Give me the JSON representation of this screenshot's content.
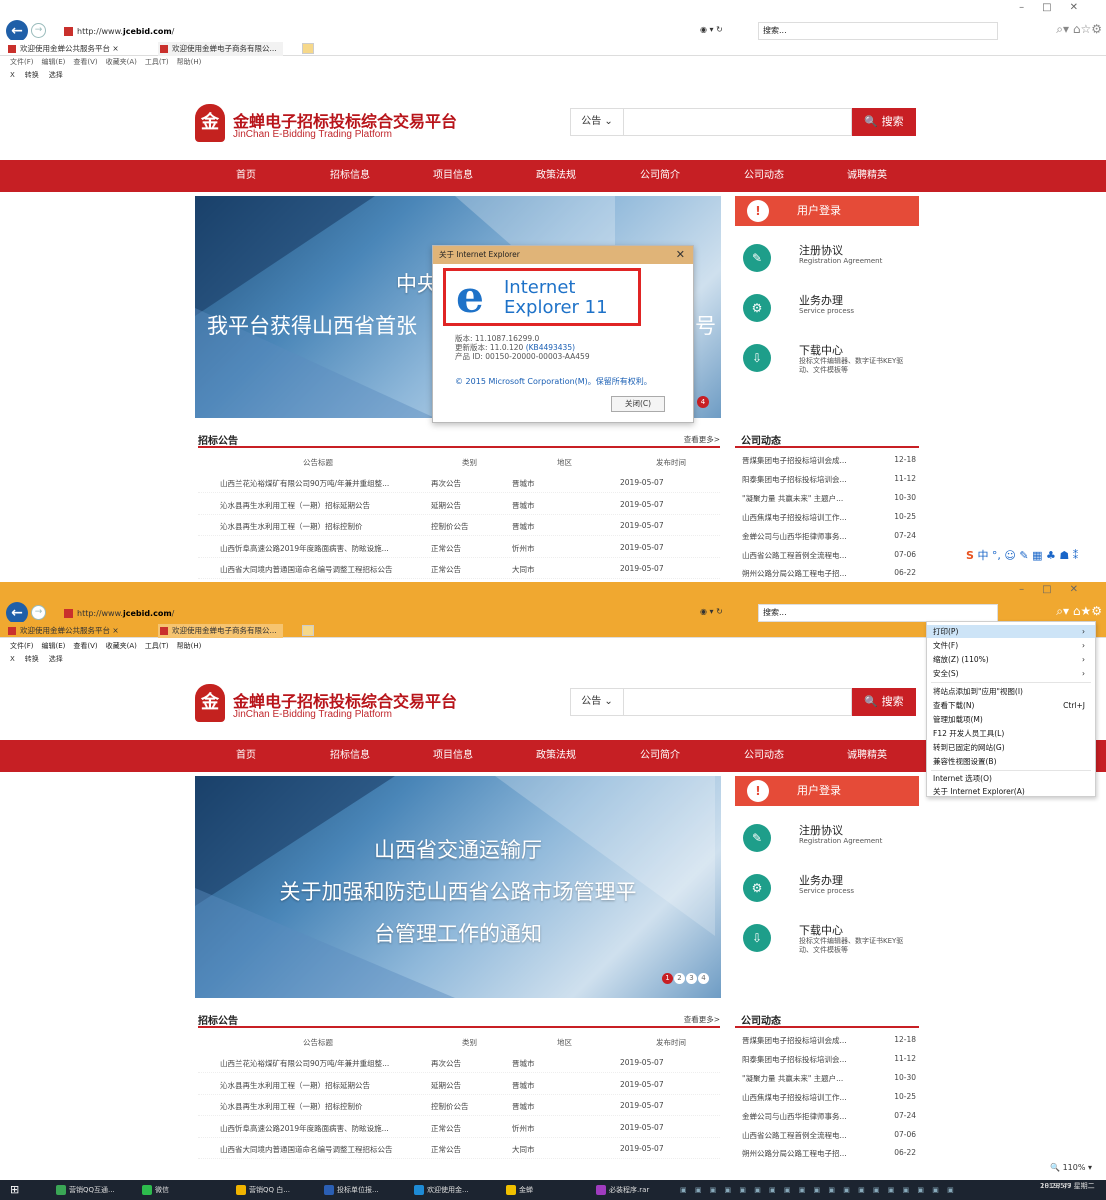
{
  "browser": {
    "url": "http://www.jcebid.com/",
    "url_prefix": "http://www.",
    "url_domain": "jcebid.com",
    "url_suffix": "/",
    "search_placeholder": "搜索...",
    "tabs": [
      "欢迎使用金蝉公共服务平台",
      "欢迎使用金蝉电子商务有限公..."
    ],
    "menu1": [
      "文件(F)",
      "编辑(E)",
      "查看(V)",
      "收藏夹(A)",
      "工具(T)",
      "帮助(H)"
    ],
    "menu2": [
      "文件(F)",
      "编辑(E)",
      "查看(V)",
      "收藏夹(A)",
      "工具(T)",
      "帮助(H)"
    ],
    "favbar": [
      "X",
      "转换",
      "选择"
    ],
    "zoom": "110%"
  },
  "site": {
    "logo_mark": "金",
    "name_cn": "金蝉电子招标投标综合交易平台",
    "name_en": "JinChan E-Bidding Trading Platform",
    "search_select": "公告 ⌄",
    "search_button": "🔍 搜索",
    "nav": [
      "首页",
      "招标信息",
      "项目信息",
      "政策法规",
      "公司简介",
      "公司动态",
      "诚聘精英"
    ],
    "banner1_line1": "中央人民",
    "banner1_line2": "我平台获得山西省首张",
    "banner1_line2_tail": "号",
    "banner2_lines": [
      "山西省交通运输厅",
      "关于加强和防范山西省公路市场管理平",
      "台管理工作的通知"
    ],
    "banner_dots": [
      "1",
      "2",
      "3",
      "4"
    ],
    "login": "用户登录",
    "services": [
      {
        "title": "注册协议",
        "sub": "Registration Agreement",
        "icon": "✎"
      },
      {
        "title": "业务办理",
        "sub": "Service process",
        "icon": "⚙"
      },
      {
        "title": "下载中心",
        "sub": "投标文件编辑器、数字证书KEY驱动、文件模板等",
        "icon": "⇩"
      }
    ],
    "notices": {
      "title": "招标公告",
      "more": "查看更多>",
      "columns": [
        "公告标题",
        "类别",
        "地区",
        "发布时间"
      ],
      "rows": [
        [
          "山西兰花沁裕煤矿有限公司90万吨/年兼并重组整...",
          "再次公告",
          "晋城市",
          "2019-05-07"
        ],
        [
          "沁水县再生水利用工程（一期）招标延期公告",
          "延期公告",
          "晋城市",
          "2019-05-07"
        ],
        [
          "沁水县再生水利用工程（一期）招标控制价",
          "控制价公告",
          "晋城市",
          "2019-05-07"
        ],
        [
          "山西忻阜高速公路2019年度路面病害、防眩设施...",
          "正常公告",
          "忻州市",
          "2019-05-07"
        ],
        [
          "山西省大同境内普通国道命名编号调整工程招标公告",
          "正常公告",
          "大同市",
          "2019-05-07"
        ]
      ]
    },
    "news": {
      "title": "公司动态",
      "rows": [
        [
          "晋煤集团电子招投标培训会成...",
          "12-18"
        ],
        [
          "阳泰集团电子招标投标培训会...",
          "11-12"
        ],
        [
          "\"凝聚力量 共赢未来\" 主题户...",
          "10-30"
        ],
        [
          "山西焦煤电子招投标培训工作...",
          "10-25"
        ],
        [
          "金蝉公司与山西华拒律师事务...",
          "07-24"
        ],
        [
          "山西省公路工程首例全流程电...",
          "07-06"
        ],
        [
          "朔州公路分局公路工程电子招...",
          "06-22"
        ]
      ]
    }
  },
  "dialog": {
    "title": "关于 Internet Explorer",
    "close_x": "✕",
    "logo_line1": "Internet",
    "logo_line2": "Explorer 11",
    "version": "版本: 11.1087.16299.0",
    "update": "更新版本: 11.0.120",
    "update_kb": "(KB4493435)",
    "product": "产品 ID: 00150-20000-00003-AA459",
    "copyright": "© 2015 Microsoft Corporation(M)。保留所有权利。",
    "close_button": "关闭(C)",
    "badge": "4"
  },
  "tools_menu": {
    "items": [
      {
        "label": "打印(P)",
        "shortcut": "›",
        "highlight": true
      },
      {
        "label": "文件(F)",
        "shortcut": "›"
      },
      {
        "label": "缩放(Z) (110%)",
        "shortcut": "›"
      },
      {
        "label": "安全(S)",
        "shortcut": "›"
      },
      {
        "label": "将站点添加到\"应用\"视图(I)",
        "shortcut": ""
      },
      {
        "label": "查看下载(N)",
        "shortcut": "Ctrl+J"
      },
      {
        "label": "管理加载项(M)",
        "shortcut": ""
      },
      {
        "label": "F12 开发人员工具(L)",
        "shortcut": ""
      },
      {
        "label": "转到已固定的网站(G)",
        "shortcut": ""
      },
      {
        "label": "兼容性视图设置(B)",
        "shortcut": ""
      },
      {
        "label": "Internet 选项(O)",
        "shortcut": ""
      },
      {
        "label": "关于 Internet Explorer(A)",
        "shortcut": ""
      }
    ]
  },
  "sogou": "中 °, ☺ ✎ ▦ ♣ ☗ ⁑",
  "taskbar": {
    "items": [
      "营销QQ互通...",
      "微信",
      "营销QQ 白...",
      "投标单位报...",
      "欢迎使用金...",
      "金蝉",
      "必装程序.rar"
    ],
    "time": "18:28:49",
    "date": "2019/5/7 星期二"
  }
}
